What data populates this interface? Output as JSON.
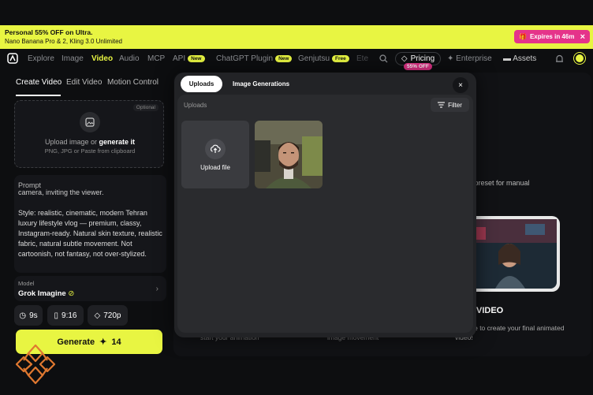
{
  "promo": {
    "line1": "Personal 55% OFF on Ultra.",
    "line2": "Nano Banana Pro & 2, Kling 3.0 Unlimited",
    "expires": "Expires in 46m",
    "close": "×"
  },
  "nav": {
    "items": [
      {
        "label": "Explore"
      },
      {
        "label": "Image"
      },
      {
        "label": "Video"
      },
      {
        "label": "Audio"
      },
      {
        "label": "MCP"
      },
      {
        "label": "API",
        "badge": "New"
      },
      {
        "label": "ChatGPT Plugin",
        "badge": "New"
      },
      {
        "label": "Genjutsu",
        "badge": "Free"
      },
      {
        "label": "Ete"
      },
      {
        "label": "Enterprise"
      },
      {
        "label": "Assets"
      }
    ],
    "pricing": "Pricing",
    "pricing_badge": "55% OFF"
  },
  "left": {
    "tabs": [
      "Create Video",
      "Edit Video",
      "Motion Control"
    ],
    "upload": {
      "optional": "Optional",
      "text_prefix": "Upload image or ",
      "text_link": "generate it",
      "sub": "PNG, JPG or Paste from clipboard"
    },
    "prompt": {
      "label": "Prompt",
      "cut": "camera, inviting the viewer.",
      "body": "Style: realistic, cinematic, modern Tehran luxury lifestyle vlog — premium, classy, Instagram-ready. Natural skin texture, realistic fabric, natural subtle movement. Not cartoonish, not fantasy, not over-stylized."
    },
    "model": {
      "label": "Model",
      "value": "Grok Imagine"
    },
    "chips": {
      "duration": "9s",
      "ratio": "9:16",
      "quality": "720p"
    },
    "generate": {
      "label": "Generate",
      "cost": "14"
    }
  },
  "background": {
    "right_text": "al preset for manual",
    "video_title": "VIDEO",
    "video_desc": "enerate to create your final animated video!",
    "cut1": "start your animation",
    "cut2": "image movement"
  },
  "modal": {
    "tab_uploads": "Uploads",
    "tab_generations": "Image Generations",
    "section_label": "Uploads",
    "filter": "Filter",
    "upload_file": "Upload file",
    "close": "×"
  },
  "colors": {
    "accent": "#e8f542",
    "pink": "#e5338a",
    "bg": "#0d0e10"
  }
}
